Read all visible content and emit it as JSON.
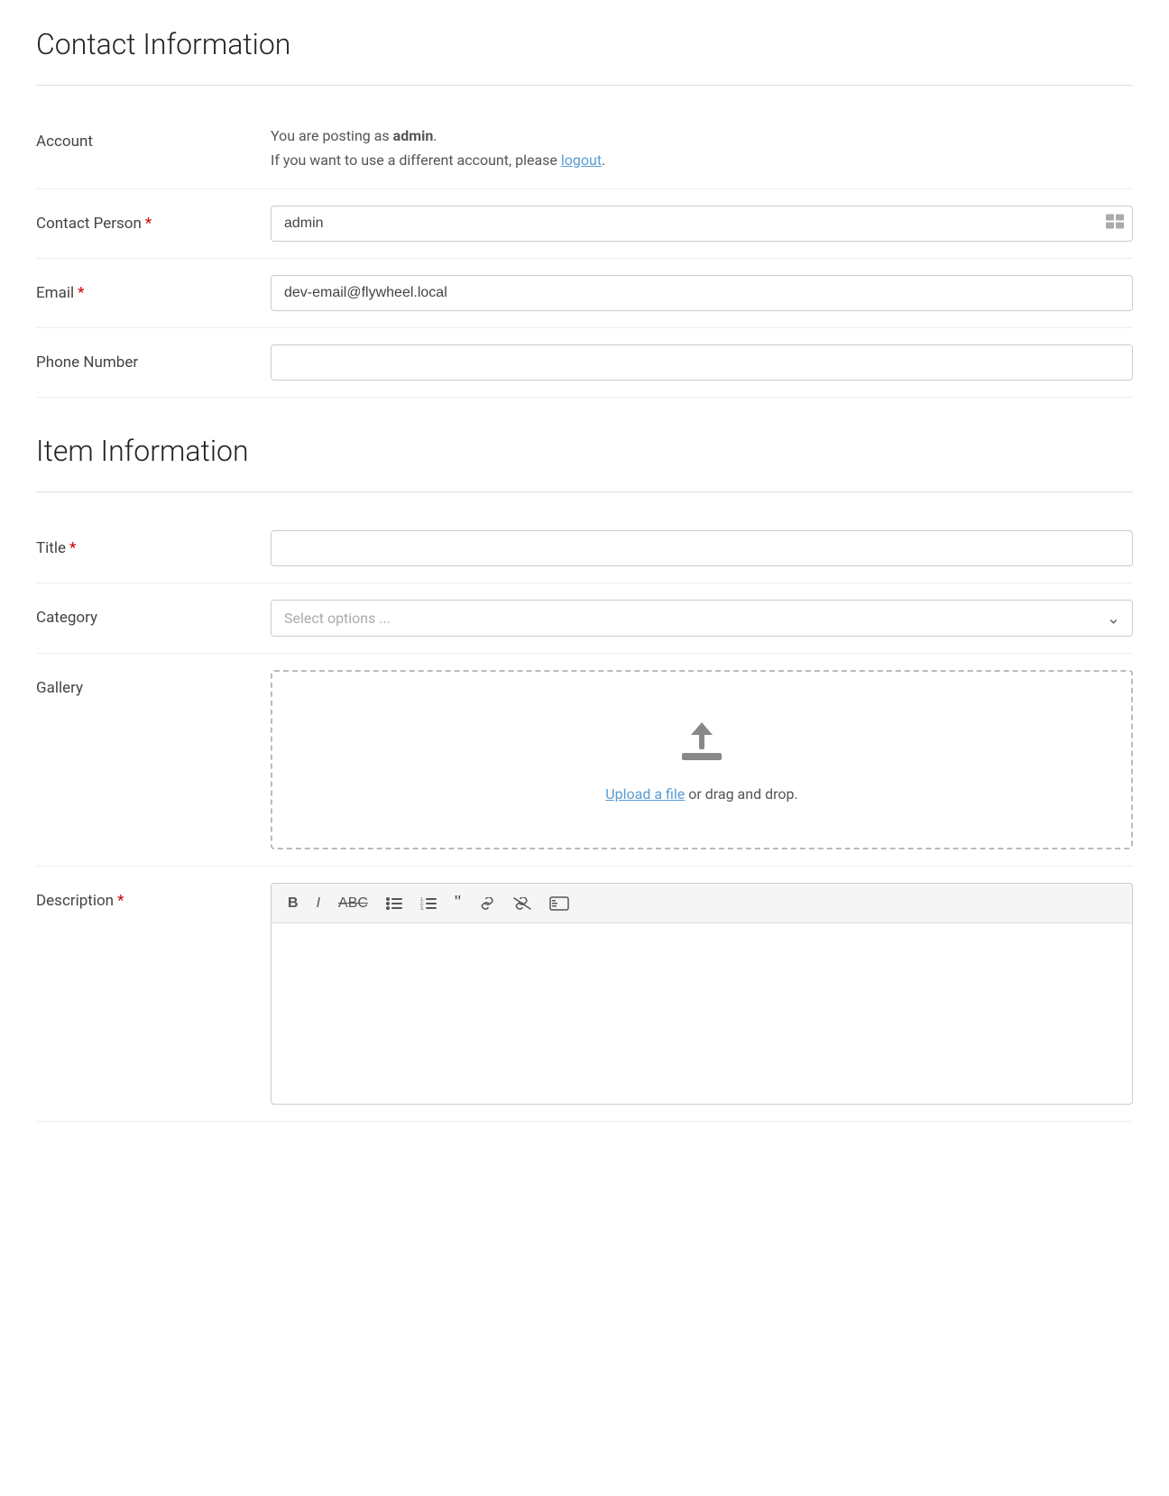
{
  "contact_section": {
    "title": "Contact Information",
    "account_row": {
      "label": "Account",
      "line1_prefix": "You are posting as ",
      "username": "admin",
      "line2_prefix": "If you want to use a different account, please ",
      "logout_text": "logout",
      "line2_suffix": "."
    },
    "contact_person_row": {
      "label": "Contact Person",
      "required": true,
      "value": "admin",
      "placeholder": ""
    },
    "email_row": {
      "label": "Email",
      "required": true,
      "value": "dev-email@flywheel.local",
      "placeholder": ""
    },
    "phone_row": {
      "label": "Phone Number",
      "required": false,
      "value": "",
      "placeholder": ""
    }
  },
  "item_section": {
    "title": "Item Information",
    "title_row": {
      "label": "Title",
      "required": true,
      "value": "",
      "placeholder": ""
    },
    "category_row": {
      "label": "Category",
      "required": false,
      "placeholder": "Select options ..."
    },
    "gallery_row": {
      "label": "Gallery",
      "upload_link": "Upload a file",
      "upload_text": " or drag and drop."
    },
    "description_row": {
      "label": "Description",
      "required": true,
      "toolbar_buttons": [
        "B",
        "I",
        "ABC",
        "≡",
        "≡",
        "❝",
        "🔗",
        "✂",
        "⌨"
      ]
    }
  }
}
